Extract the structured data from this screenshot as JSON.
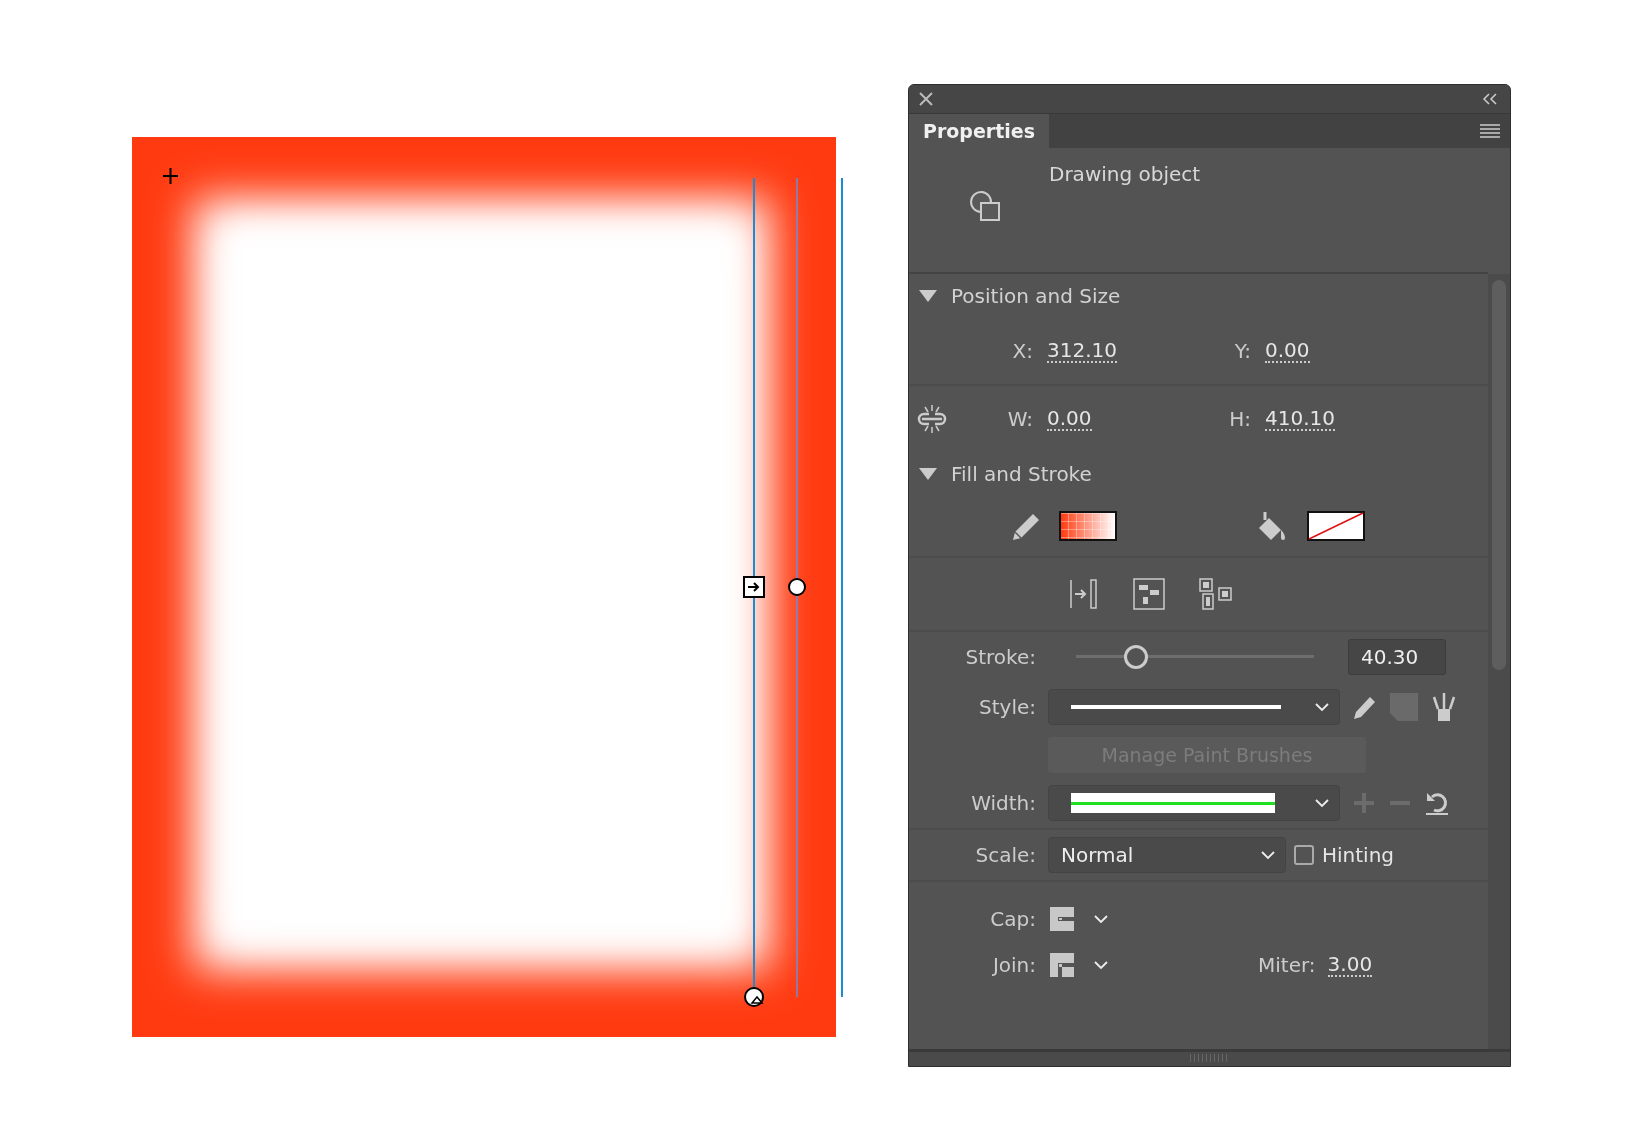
{
  "panel": {
    "tabs": [
      {
        "label": "Properties",
        "selected": true
      }
    ],
    "object_type": "Drawing object",
    "sections": [
      {
        "title": "Position and Size",
        "expanded": true
      },
      {
        "title": "Fill and Stroke",
        "expanded": true
      }
    ],
    "position": [
      {
        "label": "X:",
        "value": "312.10"
      },
      {
        "label": "Y:",
        "value": "0.00"
      },
      {
        "label": "W:",
        "value": "0.00"
      },
      {
        "label": "H:",
        "value": "410.10"
      }
    ],
    "stroke": {
      "label": "Stroke:",
      "level": 0.2,
      "value": "40.30"
    },
    "style": {
      "label": "Style:"
    },
    "manage_button": {
      "label": "Manage Paint Brushes",
      "disabled": true
    },
    "width": {
      "label": "Width:"
    },
    "scale": {
      "label": "Scale:",
      "value": "Normal"
    },
    "hinting": {
      "label": "Hinting",
      "checked": false
    },
    "cap": {
      "label": "Cap:"
    },
    "join": {
      "label": "Join:"
    },
    "miter": {
      "label": "Miter:",
      "value": "3.00"
    }
  }
}
